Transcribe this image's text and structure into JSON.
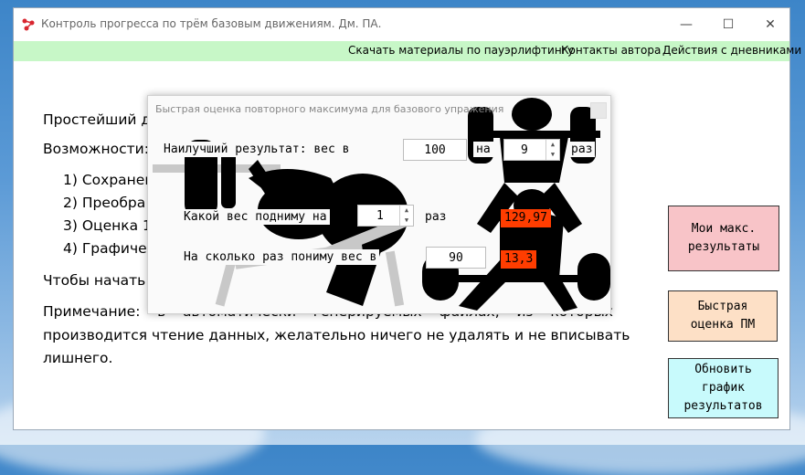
{
  "window": {
    "title": "Контроль прогресса по трём базовым движениям. Дм. ПА.",
    "minimize_symbol": "—",
    "maximize_symbol": "☐",
    "close_symbol": "✕"
  },
  "menu": {
    "items": [
      "Скачать материалы по пауэрлифтингу",
      "Контакты автора",
      "Действия с дневниками"
    ]
  },
  "content": {
    "intro": "Простейший ди",
    "capabilities": "Возможности:",
    "list": [
      "1)  Сохранен",
      "2)  Преобра",
      "3)  Оценка 1",
      "4)  Графичес"
    ],
    "start": "Чтобы начать р",
    "note_line1_words": [
      "Примечание:",
      "в",
      "автоматически",
      "генерируемых",
      "файлах,",
      "из",
      "которых"
    ],
    "note_line2": "производится чтение данных, желательно ничего не удалять и не вписывать",
    "note_line3": "лишнего."
  },
  "side_buttons": {
    "max_results": "Мои макс.\nрезультаты",
    "quick_rm": "Быстрая\nоценка ПМ",
    "update_chart": "Обновить\nграфик\nрезультатов"
  },
  "dialog": {
    "title": "Быстрая оценка повторного максимума для базового упражения",
    "best_label": "Наилучший результат: вес в",
    "best_weight": "100",
    "on_label": "на",
    "best_reps": "9",
    "times_label": "раз",
    "lift_label": "Какой вес подниму на",
    "lift_reps": "1",
    "lift_times_label": "раз",
    "lift_result": "129,97",
    "reps_label": "На сколько раз пониму вес в",
    "reps_weight": "90",
    "reps_result": "13,3"
  },
  "colors": {
    "menubar": "#c7f7c7",
    "btn_max": "#f8c4c8",
    "btn_quick": "#fde0c6",
    "btn_update": "#c8fafc",
    "result": "#ff3d00"
  }
}
